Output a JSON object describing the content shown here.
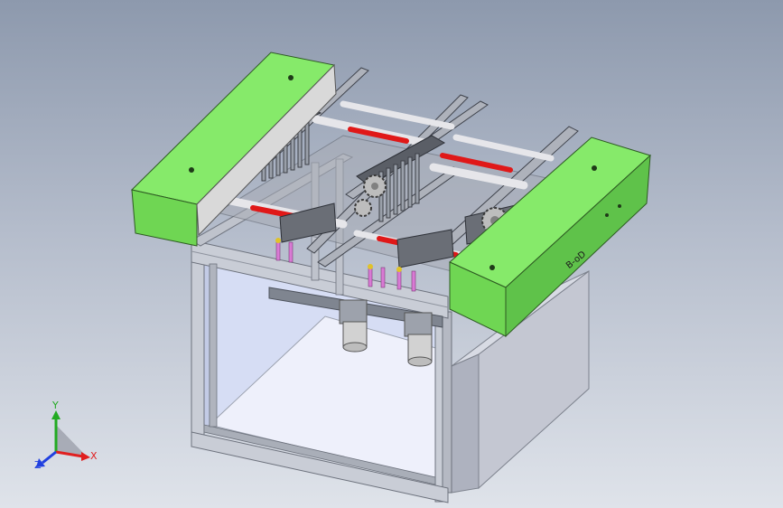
{
  "viewport": {
    "background_top": "#8d99ad",
    "background_bottom": "#dfe3ea"
  },
  "model": {
    "panel_label": "B-oD",
    "colors": {
      "green_housing": "#86ea6a",
      "green_housing_side": "#5fc24a",
      "aluminum_frame": "#c9cdd6",
      "aluminum_dark": "#8e939e",
      "red_rod": "#e01818",
      "gear_gray": "#b7b7b7",
      "enclosure_glass": "#cfd7f2",
      "enclosure_floor": "#eef0fb",
      "side_box": "#b9bcc8",
      "motor": "#d2d2d2",
      "pink_pin": "#d97ad4"
    }
  },
  "triad": {
    "x_label": "X",
    "y_label": "Y",
    "z_label": "Z",
    "x_color": "#e02020",
    "y_color": "#22aa22",
    "z_color": "#2040e0"
  }
}
